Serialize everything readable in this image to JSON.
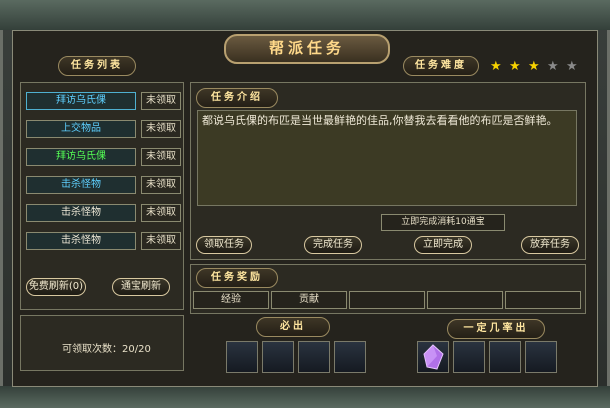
{
  "window": {
    "title": "帮派任务"
  },
  "tabs": {
    "task_list": "任务列表",
    "difficulty": "任务难度",
    "intro": "任务介绍",
    "reward": "任务奖励",
    "must_out": "必出",
    "possible_out": "一定几率出"
  },
  "difficulty_stars": {
    "filled": 3,
    "total": 5,
    "filled_color": "#f6d200",
    "empty_color": "#8a8a8a"
  },
  "tasks": [
    {
      "name": "拜访乌氏倮",
      "status": "未领取",
      "color": "#5fd0ff"
    },
    {
      "name": "上交物品",
      "status": "未领取",
      "color": "#5fd0ff"
    },
    {
      "name": "拜访乌氏倮",
      "status": "未领取",
      "color": "#55ff55"
    },
    {
      "name": "击杀怪物",
      "status": "未领取",
      "color": "#5fd0ff"
    },
    {
      "name": "击杀怪物",
      "status": "未领取",
      "color": "#f0ead8"
    },
    {
      "name": "击杀怪物",
      "status": "未领取",
      "color": "#f0ead8"
    }
  ],
  "buttons": {
    "free_refresh": "免费刷新(0)",
    "gold_refresh": "通宝刷新",
    "accept": "领取任务",
    "complete": "完成任务",
    "instant_complete": "立即完成",
    "abandon": "放弃任务"
  },
  "description": "都说乌氏倮的布匹是当世最鲜艳的佳品,你替我去看看他的布匹是否鲜艳。",
  "instant_note": "立即完成消耗10通宝",
  "rewards": [
    "经验",
    "贡献",
    "",
    "",
    ""
  ],
  "claim_count": {
    "label": "可领取次数：",
    "value": "20/20"
  }
}
